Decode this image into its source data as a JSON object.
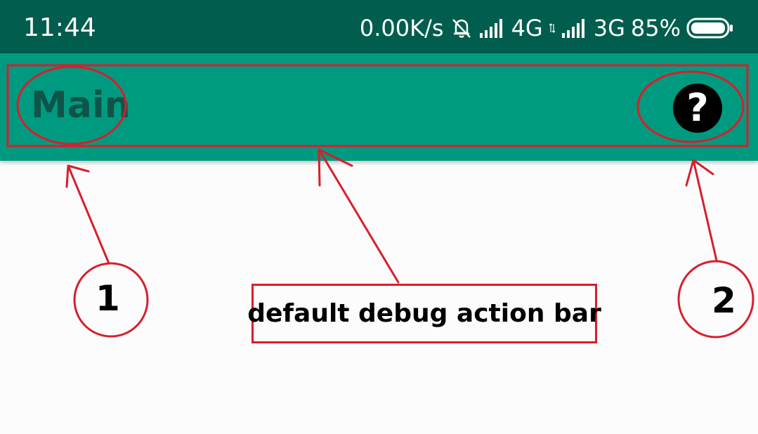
{
  "status_bar": {
    "time": "11:44",
    "speed": "0.00K/s",
    "network1": "4G",
    "network2": "3G",
    "battery": "85%",
    "icons": [
      "bell-off-icon",
      "signal-bars-icon",
      "data-arrows-icon",
      "signal-bars-icon",
      "battery-icon"
    ],
    "background_color": "#015d4d"
  },
  "app_bar": {
    "title": "Main",
    "help_icon": "question-mark-icon",
    "background_color": "#009a80",
    "title_color": "#0f5448"
  },
  "annotations": {
    "marker_1": "1",
    "marker_2": "2",
    "label": "default debug action bar",
    "color": "#d61f2c"
  }
}
